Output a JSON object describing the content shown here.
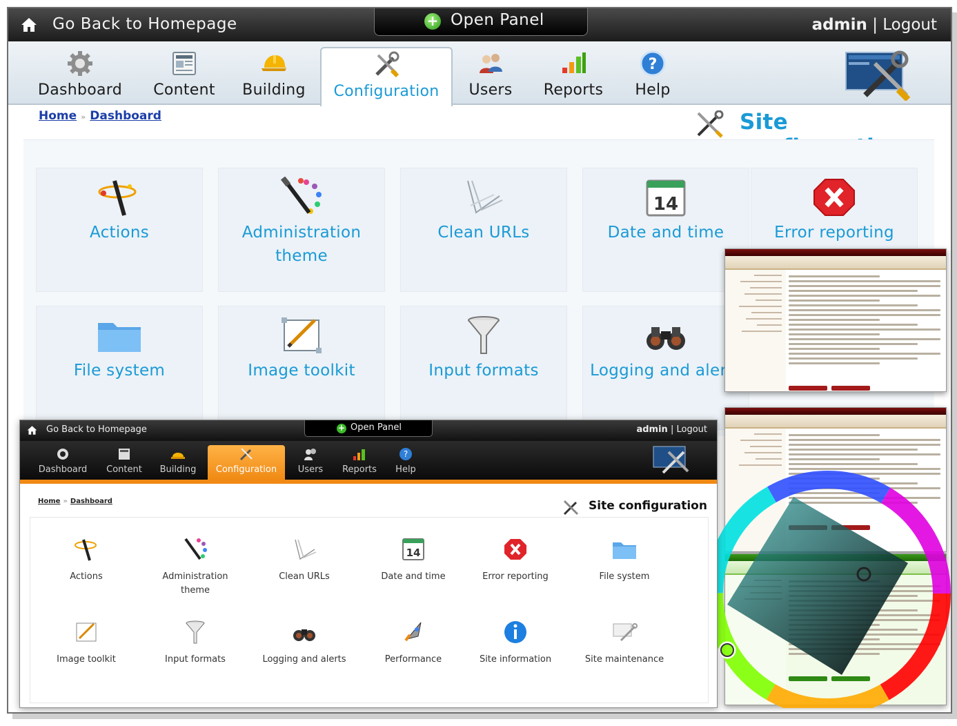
{
  "topbar": {
    "back_label": "Go Back to Homepage",
    "panel_label": "Open Panel",
    "user": "admin",
    "separator": "|",
    "logout": "Logout"
  },
  "nav": {
    "items": [
      {
        "label": "Dashboard",
        "icon": "gear-icon"
      },
      {
        "label": "Content",
        "icon": "document-icon"
      },
      {
        "label": "Building",
        "icon": "hardhat-icon"
      },
      {
        "label": "Configuration",
        "icon": "tools-icon",
        "active": true
      },
      {
        "label": "Users",
        "icon": "users-icon"
      },
      {
        "label": "Reports",
        "icon": "bar-chart-icon"
      },
      {
        "label": "Help",
        "icon": "help-icon"
      }
    ],
    "logo": "tools-logo-icon"
  },
  "breadcrumb": {
    "home": "Home",
    "separator": "»",
    "dashboard": "Dashboard"
  },
  "page_title": "Site configuration",
  "tiles": [
    {
      "label": "Actions",
      "icon": "actions-wand-icon"
    },
    {
      "label": "Administration theme",
      "icon": "brush-palette-icon"
    },
    {
      "label": "Clean URLs",
      "icon": "clean-urls-icon"
    },
    {
      "label": "Date and time",
      "icon": "calendar-icon",
      "day": "14"
    },
    {
      "label": "Error reporting",
      "icon": "error-icon"
    },
    {
      "label": "File system",
      "icon": "folder-icon"
    },
    {
      "label": "Image toolkit",
      "icon": "image-toolkit-icon"
    },
    {
      "label": "Input formats",
      "icon": "funnel-icon"
    },
    {
      "label": "Logging and alerts",
      "icon": "binoculars-icon"
    }
  ],
  "overlay": {
    "back_label": "Go Back to Homepage",
    "panel_label": "Open Panel",
    "user": "admin",
    "separator": "|",
    "logout": "Logout",
    "nav": [
      "Dashboard",
      "Content",
      "Building",
      "Configuration",
      "Users",
      "Reports",
      "Help"
    ],
    "breadcrumb": {
      "home": "Home",
      "separator": "»",
      "dashboard": "Dashboard"
    },
    "title": "Site configuration",
    "tiles": [
      {
        "label": "Actions"
      },
      {
        "label": "Administration theme"
      },
      {
        "label": "Clean URLs"
      },
      {
        "label": "Date and time",
        "day": "14"
      },
      {
        "label": "Error reporting"
      },
      {
        "label": "File system"
      },
      {
        "label": "Image toolkit"
      },
      {
        "label": "Input formats"
      },
      {
        "label": "Logging and alerts"
      },
      {
        "label": "Performance"
      },
      {
        "label": "Site information"
      },
      {
        "label": "Site maintenance"
      }
    ]
  },
  "colors": {
    "accent": "#1a9ad6",
    "link": "#1b3ea8",
    "overlay_accent": "#f08a14",
    "thumb_header": "#7a0f0f"
  }
}
